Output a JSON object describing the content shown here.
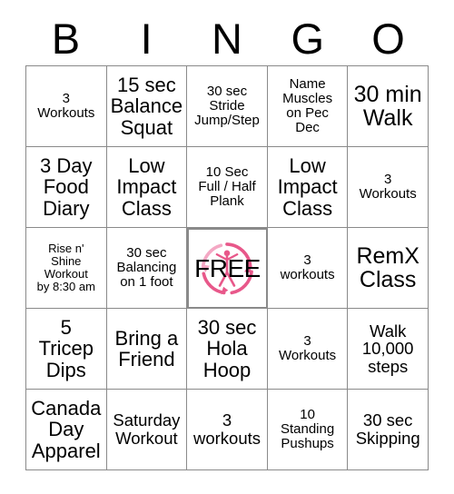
{
  "header": {
    "letters": [
      "B",
      "I",
      "N",
      "G",
      "O"
    ]
  },
  "free_space": {
    "label": "FREE",
    "logo_name": "pink-circular-fitness-logo",
    "logo_color": "#e8588a",
    "logo_color_light": "#f4a8c4"
  },
  "colors": {
    "text": "#000000",
    "border": "#8a8a8a",
    "background": "#ffffff"
  },
  "grid": {
    "rows": 5,
    "columns": 5,
    "cells": [
      {
        "text": "3\nWorkouts",
        "size": "sm"
      },
      {
        "text": "15 sec\nBalance\nSquat",
        "size": "lg"
      },
      {
        "text": "30 sec\nStride\nJump/Step",
        "size": "sm"
      },
      {
        "text": "Name\nMuscles\non Pec\nDec",
        "size": "sm"
      },
      {
        "text": "30 min\nWalk",
        "size": "xl"
      },
      {
        "text": "3 Day\nFood\nDiary",
        "size": "lg"
      },
      {
        "text": "Low\nImpact\nClass",
        "size": "lg"
      },
      {
        "text": "10 Sec\nFull / Half\nPlank",
        "size": "sm"
      },
      {
        "text": "Low\nImpact\nClass",
        "size": "lg"
      },
      {
        "text": "3\nWorkouts",
        "size": "sm"
      },
      {
        "text": "Rise n'\nShine\nWorkout\nby 8:30 am",
        "size": "xs"
      },
      {
        "text": "30 sec\nBalancing\non 1 foot",
        "size": "sm"
      },
      {
        "text": "FREE",
        "size": "free"
      },
      {
        "text": "3\nworkouts",
        "size": "sm"
      },
      {
        "text": "RemX\nClass",
        "size": "xl"
      },
      {
        "text": "5\nTricep\nDips",
        "size": "lg"
      },
      {
        "text": "Bring a\nFriend",
        "size": "lg"
      },
      {
        "text": "30 sec\nHola\nHoop",
        "size": "lg"
      },
      {
        "text": "3\nWorkouts",
        "size": "sm"
      },
      {
        "text": "Walk\n10,000\nsteps",
        "size": "md"
      },
      {
        "text": "Canada\nDay\nApparel",
        "size": "lg"
      },
      {
        "text": "Saturday\nWorkout",
        "size": "md"
      },
      {
        "text": "3\nworkouts",
        "size": "md"
      },
      {
        "text": "10\nStanding\nPushups",
        "size": "sm"
      },
      {
        "text": "30 sec\nSkipping",
        "size": "md"
      }
    ]
  }
}
